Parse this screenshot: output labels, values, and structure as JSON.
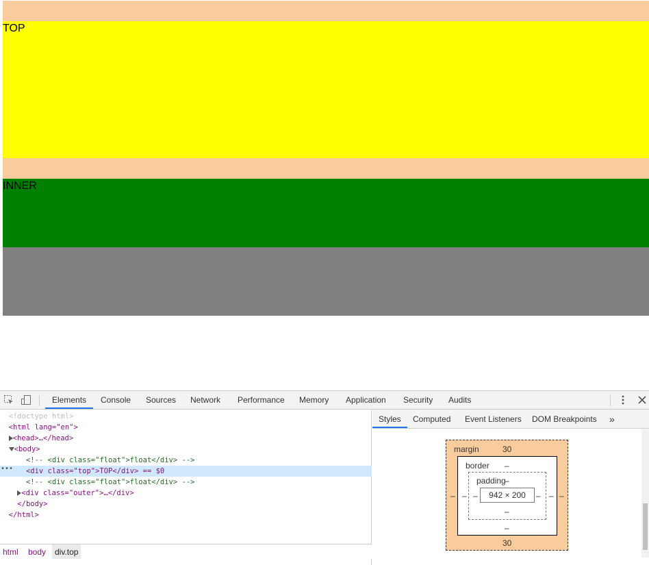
{
  "page": {
    "top_label": "TOP",
    "inner_label": "INNER",
    "colors": {
      "margin_highlight": "#f9cc9d",
      "top": "#ffff00",
      "inner": "#008000",
      "outer": "#808080"
    }
  },
  "devtools": {
    "toolbar": {
      "tabs": [
        "Elements",
        "Console",
        "Sources",
        "Network",
        "Performance",
        "Memory",
        "Application",
        "Security",
        "Audits"
      ],
      "active_tab": "Elements",
      "icons": [
        "inspect-element-icon",
        "device-toolbar-icon",
        "more-options-icon",
        "close-icon"
      ]
    },
    "elements": {
      "lines": [
        "<!doctype html>",
        "<html lang=\"en\">",
        "<head>…</head>",
        "<body>",
        "<!-- <div class=\"float\">float</div> -->",
        "<div class=\"top\">TOP</div> == $0",
        "<!-- <div class=\"float\">float</div> -->",
        "<div class=\"outer\">…</div>",
        "</body>",
        "</html>"
      ],
      "selected_index": 5
    },
    "breadcrumbs": [
      "html",
      "body",
      "div.top"
    ],
    "styles": {
      "tabs": [
        "Styles",
        "Computed",
        "Event Listeners",
        "DOM Breakpoints"
      ],
      "active_tab": "Styles",
      "more": "»",
      "box_model": {
        "margin_label": "margin",
        "margin_top": "30",
        "margin_bottom": "30",
        "margin_left": "–",
        "margin_right": "–",
        "border_label": "border",
        "border_top": "–",
        "border_bottom": "–",
        "border_left": "–",
        "border_right": "–",
        "padding_label": "padding",
        "padding_top": "–",
        "padding_bottom": "–",
        "padding_left": "–",
        "padding_right": "–",
        "content": "942 × 200"
      }
    }
  }
}
